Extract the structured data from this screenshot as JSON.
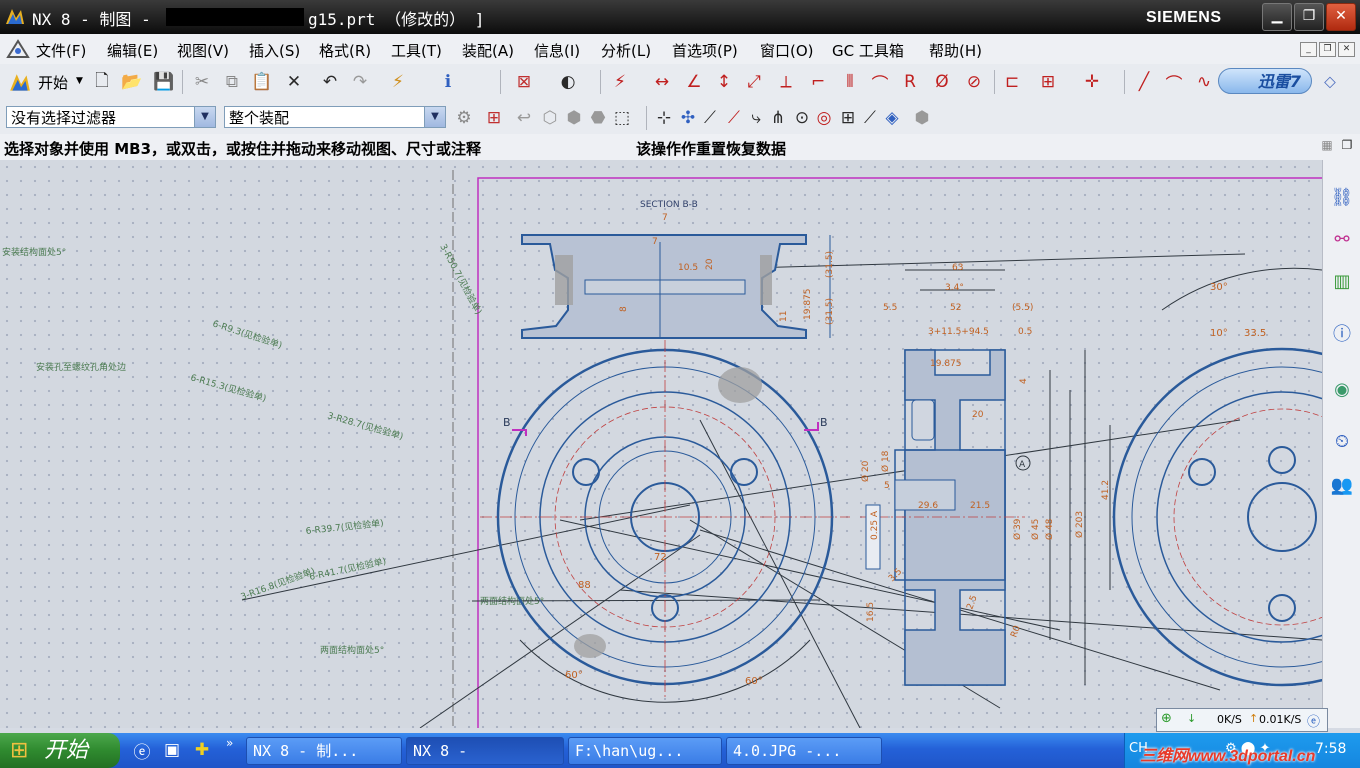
{
  "titlebar": {
    "prefix": "NX 8 - 制图 -",
    "suffix": "g15.prt （修改的） ]",
    "brand": "SIEMENS",
    "minimize": "▁",
    "restore": "❐",
    "close": "✕"
  },
  "menubar": {
    "items": [
      "文件(F)",
      "编辑(E)",
      "视图(V)",
      "插入(S)",
      "格式(R)",
      "工具(T)",
      "装配(A)",
      "信息(I)",
      "分析(L)",
      "首选项(P)",
      "窗口(O)",
      "GC 工具箱",
      "帮助(H)"
    ]
  },
  "toolbar": {
    "start_label": "开始",
    "xunlei_label": "迅雷7"
  },
  "filters": {
    "selection_filter": "没有选择过滤器",
    "assembly_scope": "整个装配"
  },
  "status": {
    "prompt": "选择对象并使用 MB3，或双击，或按住并拖动来移动视图、尺寸或注释",
    "message": "该操作作重置恢复数据"
  },
  "drawing": {
    "section_title": "SECTION B-B",
    "section_marker": "B",
    "datum_marker": "A",
    "callouts": [
      "3-R50.7(见检验单)",
      "6-R9.3(见检验单)",
      "6-R15.3(见检验单)",
      "3-R28.7(见检验单)",
      "6-R39.7(见检验单)",
      "6-R41.7(见检验单)",
      "3-R16.8(见检验单)",
      "安装结构面处5°",
      "安装孔至螺纹孔角处边",
      "两面结构面处5°",
      "两面结构面处5°"
    ],
    "dims_section": [
      "7",
      "10.5",
      "20",
      "(31.5)",
      "19.875",
      "(31.5)",
      "8",
      "11",
      "7"
    ],
    "dims_side": [
      "63",
      "3.4°",
      "52",
      "5.5",
      "(5.5)",
      "3+11.5+94.5",
      "0.5",
      "19.875",
      "20",
      "4",
      "Ø 20",
      "Ø 18",
      "5",
      "29.6",
      "21.5",
      "Ø 39",
      "Ø 45",
      "Ø 48",
      "Ø 203",
      "41.2",
      "0.25 A",
      "16.5",
      "3.5",
      "2.5",
      "R0"
    ],
    "dims_front": [
      "60°",
      "60°",
      "72",
      "88",
      "30°",
      "10°",
      "33.5"
    ]
  },
  "taskbar": {
    "start": "开始",
    "tasks": [
      "NX 8 - 制...",
      "NX 8 -",
      "F:\\han\\ug...",
      "4.0.JPG -..."
    ],
    "more": "»"
  },
  "tray": {
    "down": "0K/S",
    "up": "0.01K/S",
    "lang": "CH",
    "clock": "7:58"
  },
  "watermark": "三维网www.3dportal.cn"
}
